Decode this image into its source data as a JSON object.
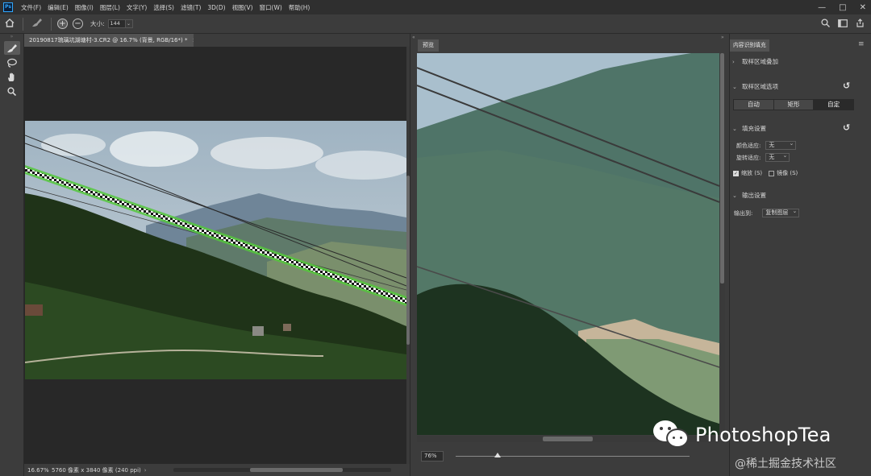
{
  "menubar": {
    "logo": "Ps",
    "items": [
      "文件(F)",
      "编辑(E)",
      "图像(I)",
      "图层(L)",
      "文字(Y)",
      "选择(S)",
      "滤镜(T)",
      "3D(D)",
      "视图(V)",
      "窗口(W)",
      "帮助(H)"
    ],
    "controls": [
      "—",
      "□",
      "✕"
    ]
  },
  "optionsbar": {
    "home_icon": "home-icon",
    "brush_icon": "brush-icon",
    "add_label": "+",
    "subtract_label": "−",
    "size_label": "大小:",
    "size_value": "144",
    "dropdown_glyph": "⌄"
  },
  "toolbar": {
    "grip": "»",
    "tools": [
      "sampling-brush-icon",
      "lasso-icon",
      "hand-icon",
      "zoom-icon"
    ]
  },
  "document": {
    "tab_title": "20190817琉璃坑湖塘村-3.CR2 @ 16.7% (背景, RGB/16*) *",
    "close_glyph": "×",
    "status_zoom": "16.67%",
    "status_dims": "5760 像素 x 3840 像素 (240 ppi)",
    "status_arrow": "›"
  },
  "preview": {
    "tab_label": "预览",
    "zoom_value": "76%"
  },
  "panel": {
    "tab_title": "内容识别填充",
    "menu_glyph": "≡",
    "sections": {
      "sampling_overlay": "取样区域叠加",
      "sampling_options": "取样区域选项",
      "fill_settings": "填充设置",
      "output_settings": "输出设置"
    },
    "segments": [
      "自动",
      "矩形",
      "自定"
    ],
    "selected_segment": 2,
    "color_adapt_label": "颜色适应:",
    "color_adapt_value": "无",
    "rotate_adapt_label": "旋转适应:",
    "rotate_adapt_value": "无",
    "scale_label": "缩放 (S)",
    "mirror_label": "镜像 (S)",
    "output_to_label": "输出到:",
    "output_to_value": "复制图层",
    "reset_glyph": "↺"
  },
  "watermark": {
    "brand": "PhotoshopTea",
    "credit": "@稀土掘金技术社区"
  },
  "colors": {
    "ps_blue": "#31a8ff",
    "selection_green": "#55c83c",
    "panel_bg": "#3c3c3c",
    "canvas_bg": "#282828"
  }
}
